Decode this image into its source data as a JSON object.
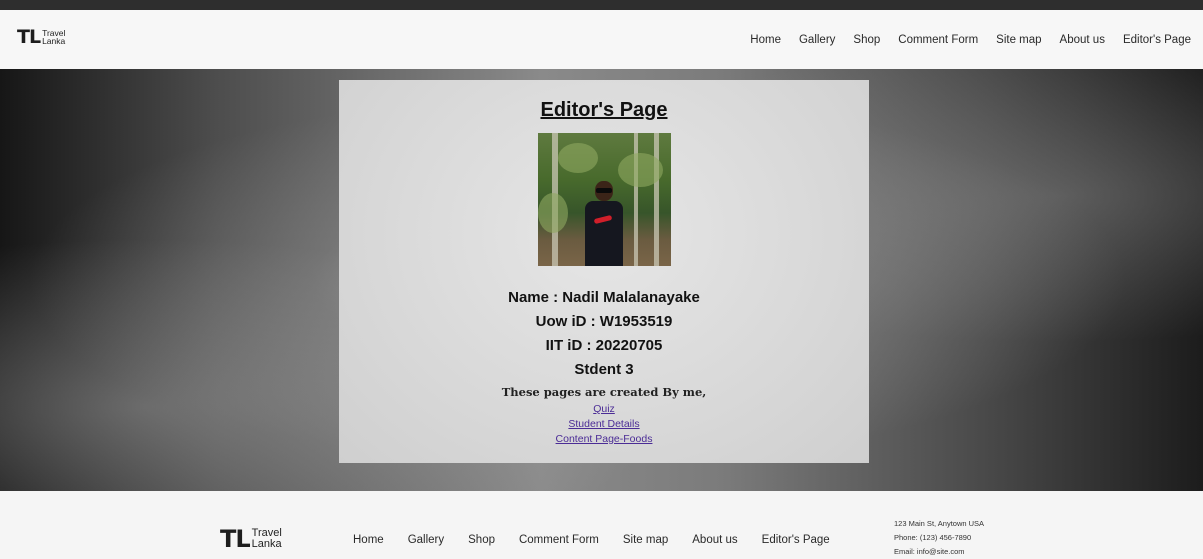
{
  "header": {
    "logo": {
      "mark": "TL",
      "line1": "Travel",
      "line2": "Lanka"
    },
    "nav": [
      "Home",
      "Gallery",
      "Shop",
      "Comment Form",
      "Site map",
      "About us",
      "Editor's Page"
    ]
  },
  "card": {
    "title": "Editor's Page",
    "name_line": "Name : Nadil Malalanayake",
    "uow_line": "Uow iD : W1953519",
    "iit_line": "IIT iD : 20220705",
    "student_line": "Stdent 3",
    "credit": "These pages are created By me,",
    "links": [
      "Quiz",
      "Student Details",
      "Content Page-Foods"
    ]
  },
  "footer": {
    "logo": {
      "mark": "TL",
      "line1": "Travel",
      "line2": "Lanka"
    },
    "nav": [
      "Home",
      "Gallery",
      "Shop",
      "Comment Form",
      "Site map",
      "About us",
      "Editor's Page"
    ],
    "address": "123 Main St, Anytown USA",
    "phone": "Phone: (123) 456-7890",
    "email": "Email: info@site.com"
  },
  "colors": {
    "header_bg": "#f7f7f7",
    "card_bg": "#dcdcdc",
    "link": "#4b2c96",
    "top_rule": "#2e2e2e"
  }
}
